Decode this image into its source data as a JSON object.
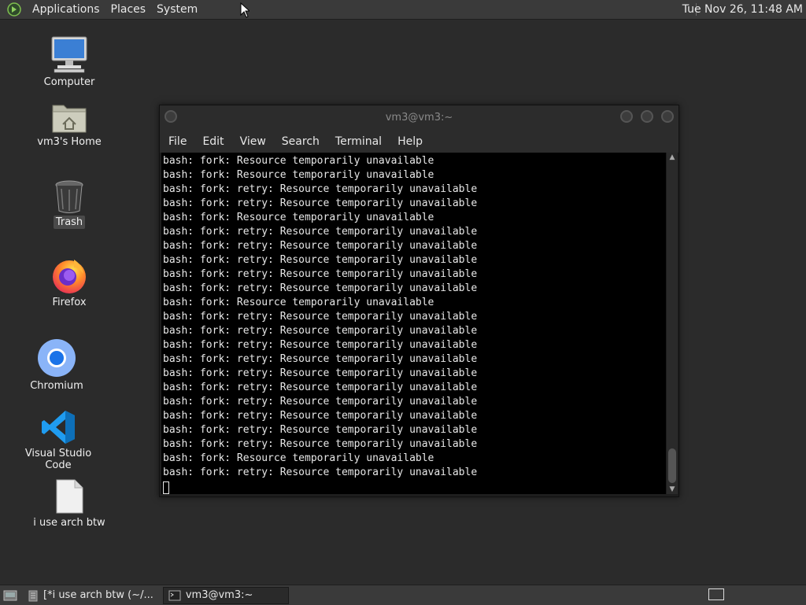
{
  "top_panel": {
    "menus": [
      "Applications",
      "Places",
      "System"
    ],
    "clock": "Tue Nov 26, 11:48 AM"
  },
  "desktop_icons": [
    {
      "label": "Computer",
      "icon": "computer-icon"
    },
    {
      "label": "vm3's Home",
      "icon": "home-folder-icon"
    },
    {
      "label": "Trash",
      "icon": "trash-icon"
    },
    {
      "label": "Firefox",
      "icon": "firefox-icon"
    },
    {
      "label": "Chromium",
      "icon": "chromium-icon"
    },
    {
      "label": "Visual Studio Code",
      "icon": "vscode-icon"
    },
    {
      "label": "i use arch btw",
      "icon": "text-file-icon"
    }
  ],
  "terminal": {
    "title": "vm3@vm3:~",
    "menus": [
      "File",
      "Edit",
      "View",
      "Search",
      "Terminal",
      "Help"
    ],
    "lines": [
      "bash: fork: Resource temporarily unavailable",
      "bash: fork: Resource temporarily unavailable",
      "bash: fork: retry: Resource temporarily unavailable",
      "bash: fork: retry: Resource temporarily unavailable",
      "bash: fork: Resource temporarily unavailable",
      "bash: fork: retry: Resource temporarily unavailable",
      "bash: fork: retry: Resource temporarily unavailable",
      "bash: fork: retry: Resource temporarily unavailable",
      "bash: fork: retry: Resource temporarily unavailable",
      "bash: fork: retry: Resource temporarily unavailable",
      "bash: fork: Resource temporarily unavailable",
      "bash: fork: retry: Resource temporarily unavailable",
      "bash: fork: retry: Resource temporarily unavailable",
      "bash: fork: retry: Resource temporarily unavailable",
      "bash: fork: retry: Resource temporarily unavailable",
      "bash: fork: retry: Resource temporarily unavailable",
      "bash: fork: retry: Resource temporarily unavailable",
      "bash: fork: retry: Resource temporarily unavailable",
      "bash: fork: retry: Resource temporarily unavailable",
      "bash: fork: retry: Resource temporarily unavailable",
      "bash: fork: retry: Resource temporarily unavailable",
      "bash: fork: Resource temporarily unavailable",
      "bash: fork: retry: Resource temporarily unavailable"
    ]
  },
  "taskbar": {
    "tasks": [
      {
        "label": "[*i use arch btw (~/...",
        "icon": "text-editor-icon"
      },
      {
        "label": "vm3@vm3:~",
        "icon": "terminal-icon"
      }
    ]
  },
  "colors": {
    "desktop_bg": "#2b2b2b",
    "panel_bg": "#3a3a3a",
    "terminal_bg": "#000000"
  }
}
